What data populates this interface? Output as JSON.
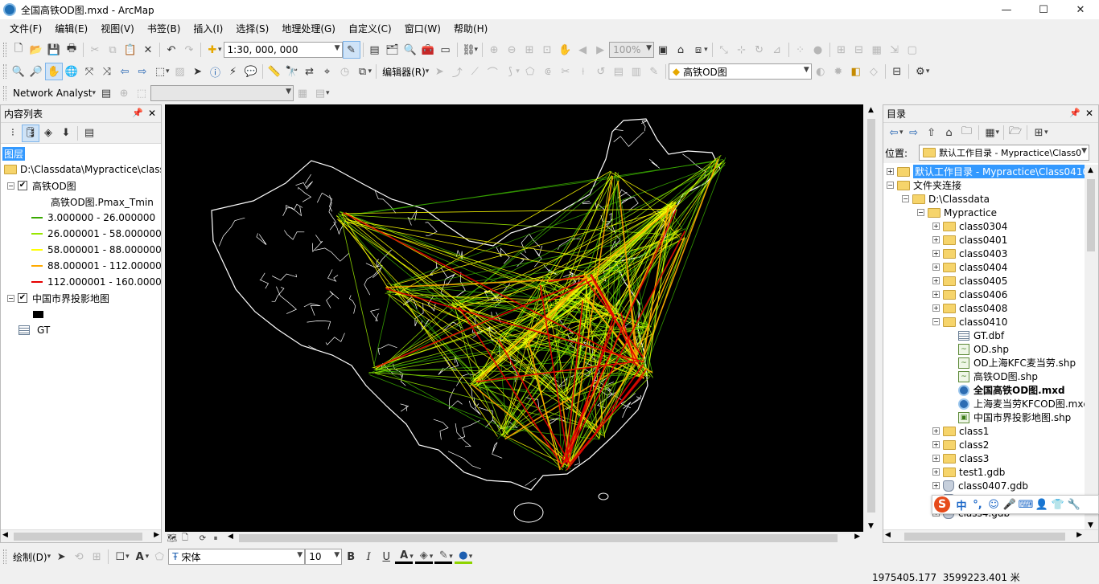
{
  "window": {
    "title": "全国高铁OD图.mxd - ArcMap",
    "minimize": "—",
    "maximize": "☐",
    "close": "✕"
  },
  "menu": [
    "文件(F)",
    "编辑(E)",
    "视图(V)",
    "书签(B)",
    "插入(I)",
    "选择(S)",
    "地理处理(G)",
    "自定义(C)",
    "窗口(W)",
    "帮助(H)"
  ],
  "toolbar1": {
    "scale": "1:30, 000, 000",
    "zoom": "100%"
  },
  "toolbar2": {
    "editor": "编辑器(R)",
    "layer_select": "高铁OD图"
  },
  "toolbar3": {
    "network_analyst": "Network Analyst"
  },
  "toc": {
    "title": "内容列表",
    "layers_header": "图层",
    "path": "D:\\Classdata\\Mypractice\\class",
    "layer1": {
      "name": "高铁OD图",
      "field": "高铁OD图.Pmax_Tmin",
      "checked": true
    },
    "classes": [
      {
        "label": "3.000000 - 26.000000",
        "color": "#38a800"
      },
      {
        "label": "26.000001 - 58.000000",
        "color": "#98e600"
      },
      {
        "label": "58.000001 - 88.000000",
        "color": "#ffff00"
      },
      {
        "label": "88.000001 - 112.000000",
        "color": "#ffaa00"
      },
      {
        "label": "112.000001 - 160.000000",
        "color": "#e60000"
      }
    ],
    "layer2": {
      "name": "中国市界投影地图",
      "checked": true,
      "fill": "#000000"
    },
    "table": {
      "name": "GT"
    }
  },
  "catalog": {
    "title": "目录",
    "location_label": "位置:",
    "location_value": "默认工作目录 - Mypractice\\Class0",
    "tree": [
      {
        "label": "默认工作目录 - Mypractice\\Class0410",
        "level": 0,
        "icon": "home-folder",
        "exp": "+",
        "selected": true
      },
      {
        "label": "文件夹连接",
        "level": 0,
        "icon": "folder",
        "exp": "-"
      },
      {
        "label": "D:\\Classdata",
        "level": 1,
        "icon": "folder",
        "exp": "-"
      },
      {
        "label": "Mypractice",
        "level": 2,
        "icon": "folder",
        "exp": "-"
      },
      {
        "label": "class0304",
        "level": 3,
        "icon": "folder",
        "exp": "+"
      },
      {
        "label": "class0401",
        "level": 3,
        "icon": "folder",
        "exp": "+"
      },
      {
        "label": "class0403",
        "level": 3,
        "icon": "folder",
        "exp": "+"
      },
      {
        "label": "class0404",
        "level": 3,
        "icon": "folder",
        "exp": "+"
      },
      {
        "label": "class0405",
        "level": 3,
        "icon": "folder",
        "exp": "+"
      },
      {
        "label": "class0406",
        "level": 3,
        "icon": "folder",
        "exp": "+"
      },
      {
        "label": "class0408",
        "level": 3,
        "icon": "folder",
        "exp": "+"
      },
      {
        "label": "class0410",
        "level": 3,
        "icon": "folder",
        "exp": "-"
      },
      {
        "label": "GT.dbf",
        "level": 4,
        "icon": "table"
      },
      {
        "label": "OD.shp",
        "level": 4,
        "icon": "line-shp"
      },
      {
        "label": "OD上海KFC麦当劳.shp",
        "level": 4,
        "icon": "line-shp"
      },
      {
        "label": "高铁OD图.shp",
        "level": 4,
        "icon": "line-shp"
      },
      {
        "label": "全国高铁OD图.mxd",
        "level": 4,
        "icon": "mxd",
        "bold": true
      },
      {
        "label": "上海麦当劳KFCOD图.mxd",
        "level": 4,
        "icon": "mxd"
      },
      {
        "label": "中国市界投影地图.shp",
        "level": 4,
        "icon": "poly-shp"
      },
      {
        "label": "class1",
        "level": 3,
        "icon": "folder",
        "exp": "+"
      },
      {
        "label": "class2",
        "level": 3,
        "icon": "folder",
        "exp": "+"
      },
      {
        "label": "class3",
        "level": 3,
        "icon": "folder",
        "exp": "+"
      },
      {
        "label": "test1.gdb",
        "level": 3,
        "icon": "folder",
        "exp": "+"
      },
      {
        "label": "class0407.gdb",
        "level": 3,
        "icon": "gdb",
        "exp": "+"
      },
      {
        "label": "class0407.gdb",
        "level": 3,
        "icon": "gdb",
        "exp": "+"
      },
      {
        "label": "class4.gdb",
        "level": 3,
        "icon": "gdb",
        "exp": "+"
      }
    ]
  },
  "drawing": {
    "label": "绘制(D)",
    "font": "宋体",
    "size": "10",
    "bold": "B",
    "italic": "I",
    "underline": "U",
    "font_color_letter": "A"
  },
  "status": {
    "coords": "1975405.177  3599223.401 米"
  },
  "ime": {
    "logo": "S",
    "items": [
      "中",
      "°,",
      "☺",
      "🎤",
      "⌨",
      "👤",
      "👕",
      "🔧"
    ]
  }
}
